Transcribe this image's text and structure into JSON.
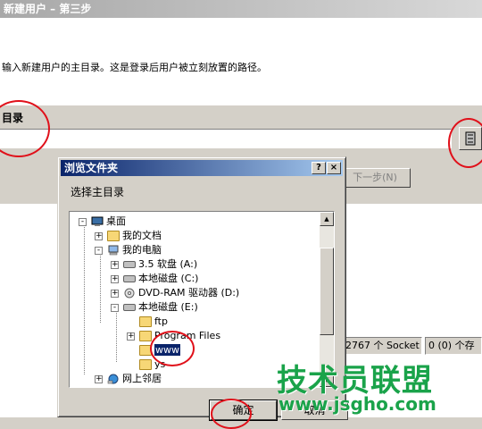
{
  "wizard": {
    "title": "新建用户 – 第三步",
    "instruction": "输入新建用户的主目录。这是登录后用户被立刻放置的路径。",
    "home_dir_label": "目录",
    "next_button": "下一步(N)",
    "status_connections": "2767 个 Socket",
    "status_counts": "0 (0) 个存"
  },
  "dialog": {
    "title": "浏览文件夹",
    "help_button": "?",
    "close_button": "×",
    "prompt": "选择主目录",
    "tree": [
      {
        "label": "桌面",
        "icon": "desktop-icon",
        "expander": "-"
      },
      {
        "label": "我的文档",
        "icon": "my-documents-icon",
        "expander": "+"
      },
      {
        "label": "我的电脑",
        "icon": "my-computer-icon",
        "expander": "-"
      },
      {
        "label": "3.5 软盘 (A:)",
        "icon": "floppy-drive-icon",
        "expander": "+"
      },
      {
        "label": "本地磁盘 (C:)",
        "icon": "hard-drive-icon",
        "expander": "+"
      },
      {
        "label": "DVD-RAM 驱动器 (D:)",
        "icon": "dvd-drive-icon",
        "expander": "+"
      },
      {
        "label": "本地磁盘 (E:)",
        "icon": "hard-drive-icon",
        "expander": "-"
      },
      {
        "label": "ftp",
        "icon": "folder-icon",
        "expander": ""
      },
      {
        "label": "Program Files",
        "icon": "folder-icon",
        "expander": "+"
      },
      {
        "label": "www",
        "icon": "folder-icon",
        "expander": ""
      },
      {
        "label": "ys",
        "icon": "folder-icon",
        "expander": ""
      },
      {
        "label": "网上邻居",
        "icon": "network-icon",
        "expander": "+"
      }
    ],
    "ok_button": "确定",
    "cancel_button": "取消"
  },
  "watermark": {
    "brand": "技术员联盟",
    "url": "www.jsgho.com",
    "color": "#1aa34a"
  },
  "annotation_color": "#e0101a"
}
